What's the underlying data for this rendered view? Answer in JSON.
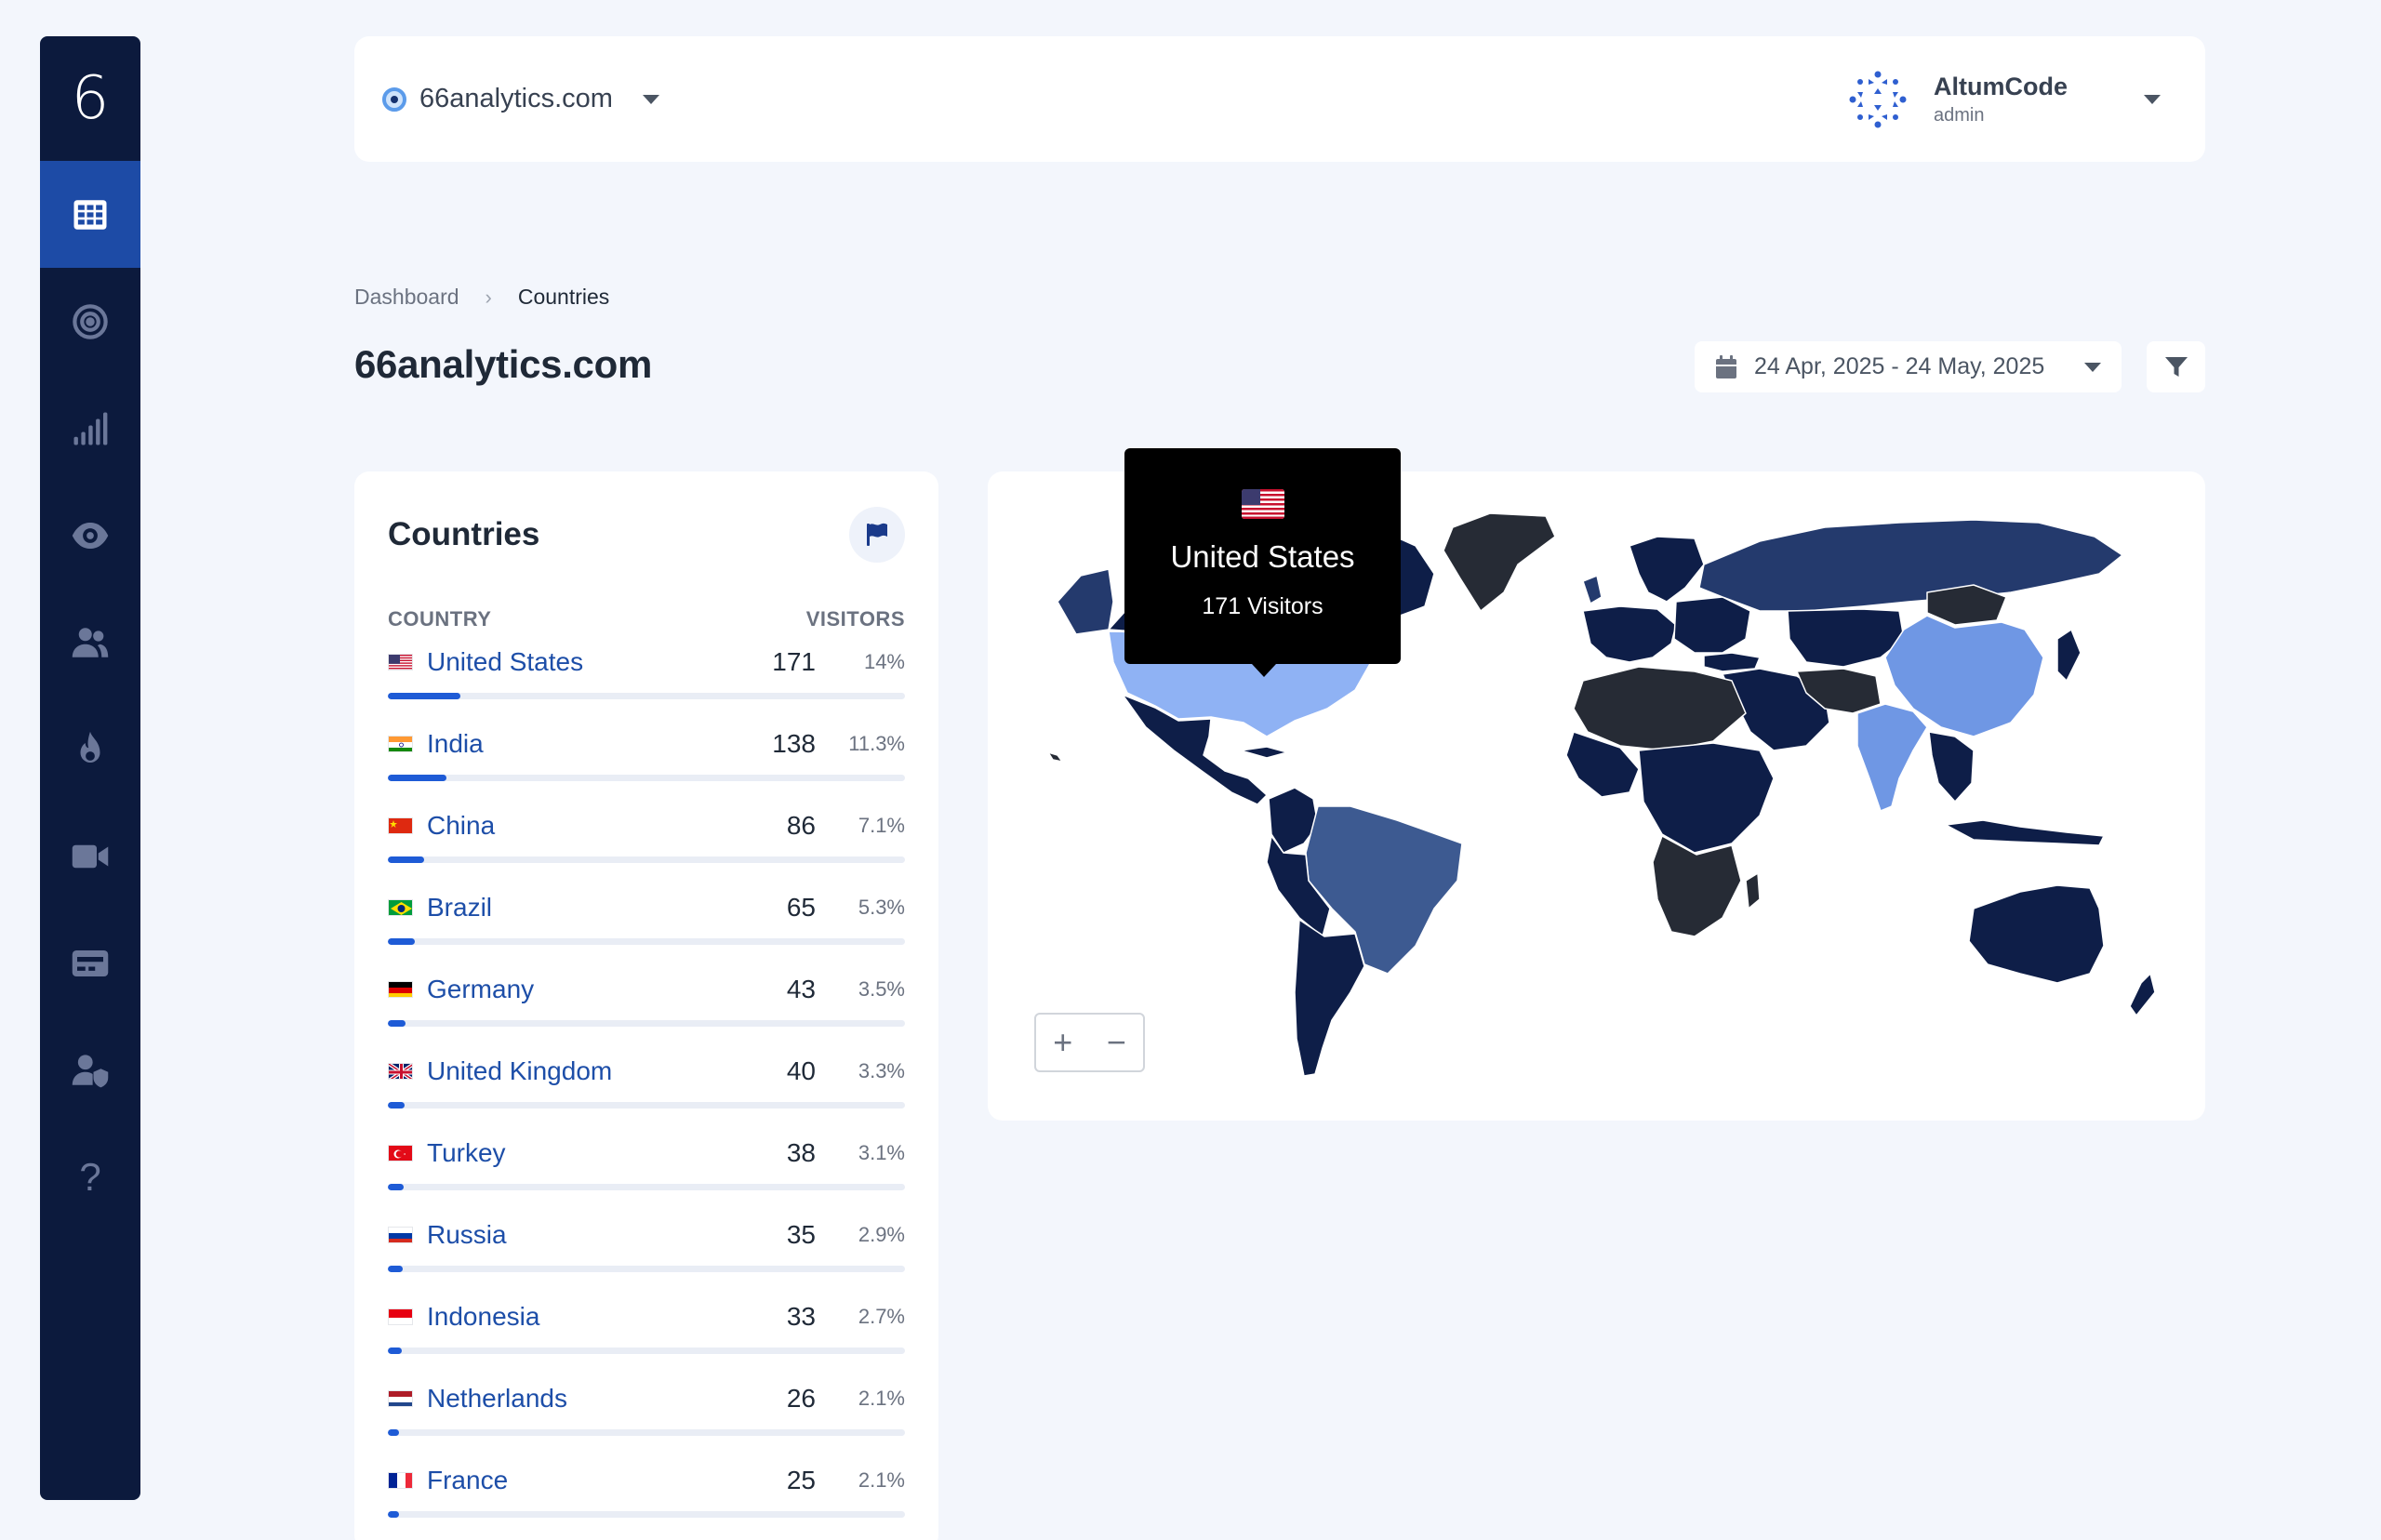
{
  "app": {
    "logo_glyph": "6"
  },
  "sidebar": {
    "items": [
      {
        "name": "dashboard",
        "icon": "grid-icon",
        "active": true
      },
      {
        "name": "goals",
        "icon": "target-icon",
        "active": false
      },
      {
        "name": "realtime",
        "icon": "signal-icon",
        "active": false
      },
      {
        "name": "visitors",
        "icon": "eye-icon",
        "active": false
      },
      {
        "name": "users",
        "icon": "users-icon",
        "active": false
      },
      {
        "name": "heatmaps",
        "icon": "fire-icon",
        "active": false
      },
      {
        "name": "replays",
        "icon": "video-icon",
        "active": false
      },
      {
        "name": "billing",
        "icon": "card-icon",
        "active": false
      },
      {
        "name": "admin",
        "icon": "user-shield-icon",
        "active": false
      },
      {
        "name": "help",
        "icon": "question-icon",
        "glyph": "?",
        "active": false
      }
    ]
  },
  "header": {
    "website": "66analytics.com",
    "user": {
      "name": "AltumCode",
      "role": "admin"
    }
  },
  "breadcrumb": {
    "parent": "Dashboard",
    "current": "Countries"
  },
  "page": {
    "title": "66analytics.com"
  },
  "date_range": {
    "label": "24 Apr, 2025 - 24 May, 2025"
  },
  "countries_card": {
    "title": "Countries",
    "col_country": "COUNTRY",
    "col_visitors": "VISITORS",
    "rows": [
      {
        "country": "United States",
        "flag": "us",
        "visitors": "171",
        "percent": "14%",
        "share": 0.14
      },
      {
        "country": "India",
        "flag": "in",
        "visitors": "138",
        "percent": "11.3%",
        "share": 0.113
      },
      {
        "country": "China",
        "flag": "cn",
        "visitors": "86",
        "percent": "7.1%",
        "share": 0.071
      },
      {
        "country": "Brazil",
        "flag": "br",
        "visitors": "65",
        "percent": "5.3%",
        "share": 0.053
      },
      {
        "country": "Germany",
        "flag": "de",
        "visitors": "43",
        "percent": "3.5%",
        "share": 0.035
      },
      {
        "country": "United Kingdom",
        "flag": "gb",
        "visitors": "40",
        "percent": "3.3%",
        "share": 0.033
      },
      {
        "country": "Turkey",
        "flag": "tr",
        "visitors": "38",
        "percent": "3.1%",
        "share": 0.031
      },
      {
        "country": "Russia",
        "flag": "ru",
        "visitors": "35",
        "percent": "2.9%",
        "share": 0.029
      },
      {
        "country": "Indonesia",
        "flag": "id",
        "visitors": "33",
        "percent": "2.7%",
        "share": 0.027
      },
      {
        "country": "Netherlands",
        "flag": "nl",
        "visitors": "26",
        "percent": "2.1%",
        "share": 0.021
      },
      {
        "country": "France",
        "flag": "fr",
        "visitors": "25",
        "percent": "2.1%",
        "share": 0.021
      }
    ]
  },
  "map": {
    "tooltip": {
      "country": "United States",
      "visitors": "171 Visitors"
    },
    "zoom_in": "+",
    "zoom_out": "−",
    "colors": {
      "highest": "#8fb2f4",
      "high": "#6f97e4",
      "mid": "#3d5a91",
      "low": "#243a6d",
      "lowest": "#0e1e48",
      "none": "#262b35"
    }
  },
  "colors": {
    "accent": "#1e5bd6",
    "link": "#1d4ea8",
    "sidebar": "#0c1a3d",
    "sidebar_active": "#1d4ba6"
  }
}
